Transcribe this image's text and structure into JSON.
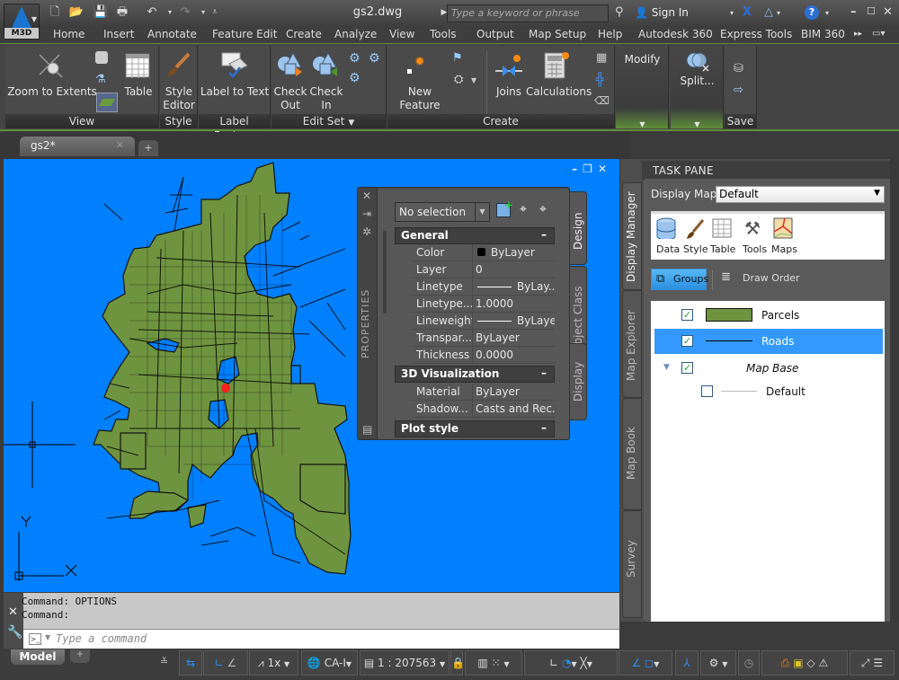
{
  "app": {
    "logo_label": "M3D",
    "document_title": "gs2.dwg",
    "search_placeholder": "Type a keyword or phrase",
    "sign_in": "Sign In"
  },
  "menu": [
    "Home",
    "Insert",
    "Annotate",
    "Feature Edit",
    "Create",
    "Analyze",
    "View",
    "Tools",
    "Output",
    "Map Setup",
    "Help",
    "Autodesk 360",
    "Express Tools",
    "BIM 360"
  ],
  "ribbon": {
    "view": {
      "title": "View",
      "zoom_extents": "Zoom to Extents"
    },
    "table": {
      "label": "Table"
    },
    "style": {
      "title": "Style",
      "style_editor": "Style Editor"
    },
    "label_feature": {
      "title": "Label Feature",
      "label_to_text": "Label to Text"
    },
    "edit_set": {
      "title": "Edit Set",
      "check_out": "Check Out",
      "check_in": "Check In"
    },
    "create": {
      "title": "Create",
      "new_feature": "New Feature",
      "joins": "Joins",
      "calculations": "Calculations"
    },
    "modify": {
      "title": "Modify"
    },
    "split": {
      "label": "Split..."
    },
    "save": {
      "title": "Save"
    }
  },
  "doc_tabs": [
    {
      "label": "gs2*",
      "active": true
    }
  ],
  "colors": {
    "canvas_bg": "#0080ff",
    "parcel_fill": "#6f9440",
    "selection_blue": "#3399ff",
    "ribbon_accent": "#5e8f3a"
  },
  "properties": {
    "title": "PROPERTIES",
    "selection": "No selection",
    "categories": [
      {
        "name": "General",
        "rows": [
          {
            "key": "Color",
            "value": "ByLayer",
            "swatch": "#000000"
          },
          {
            "key": "Layer",
            "value": "0"
          },
          {
            "key": "Linetype",
            "value": "ByLay...",
            "line": true
          },
          {
            "key": "Linetype...",
            "value": "1.0000"
          },
          {
            "key": "Lineweight",
            "value": "ByLayer",
            "line": true
          },
          {
            "key": "Transpar...",
            "value": "ByLayer"
          },
          {
            "key": "Thickness",
            "value": "0.0000"
          }
        ]
      },
      {
        "name": "3D Visualization",
        "rows": [
          {
            "key": "Material",
            "value": "ByLayer"
          },
          {
            "key": "Shadow...",
            "value": "Casts and Rec..."
          }
        ]
      },
      {
        "name": "Plot style",
        "rows": []
      }
    ],
    "side_tabs": [
      "Design",
      "Object Class",
      "Display"
    ]
  },
  "task_pane": {
    "title": "TASK PANE",
    "display_map_label": "Display Map:",
    "display_map_value": "Default",
    "toolbar": [
      "Data",
      "Style",
      "Table",
      "Tools",
      "Maps"
    ],
    "groups_label": "Groups",
    "draw_order_label": "Draw Order",
    "layers": [
      {
        "name": "Parcels",
        "checked": true,
        "selected": false,
        "symbol": "fill"
      },
      {
        "name": "Roads",
        "checked": true,
        "selected": true,
        "symbol": "line"
      },
      {
        "name": "Map Base",
        "checked": true,
        "selected": false,
        "symbol": "group"
      },
      {
        "name": "Default",
        "checked": false,
        "selected": false,
        "symbol": "thin-line"
      }
    ],
    "side_tabs": [
      "Display Manager",
      "Map Explorer",
      "Map Book",
      "Survey"
    ]
  },
  "command": {
    "history": [
      "Command: OPTIONS",
      "Command:"
    ],
    "placeholder": "Type a command"
  },
  "ucs": {
    "x": "X",
    "y": "Y"
  },
  "status": {
    "model_tab": "Model",
    "annotation_scale": "1x",
    "coord_system": "CA-I",
    "scale": "1 : 207563"
  }
}
